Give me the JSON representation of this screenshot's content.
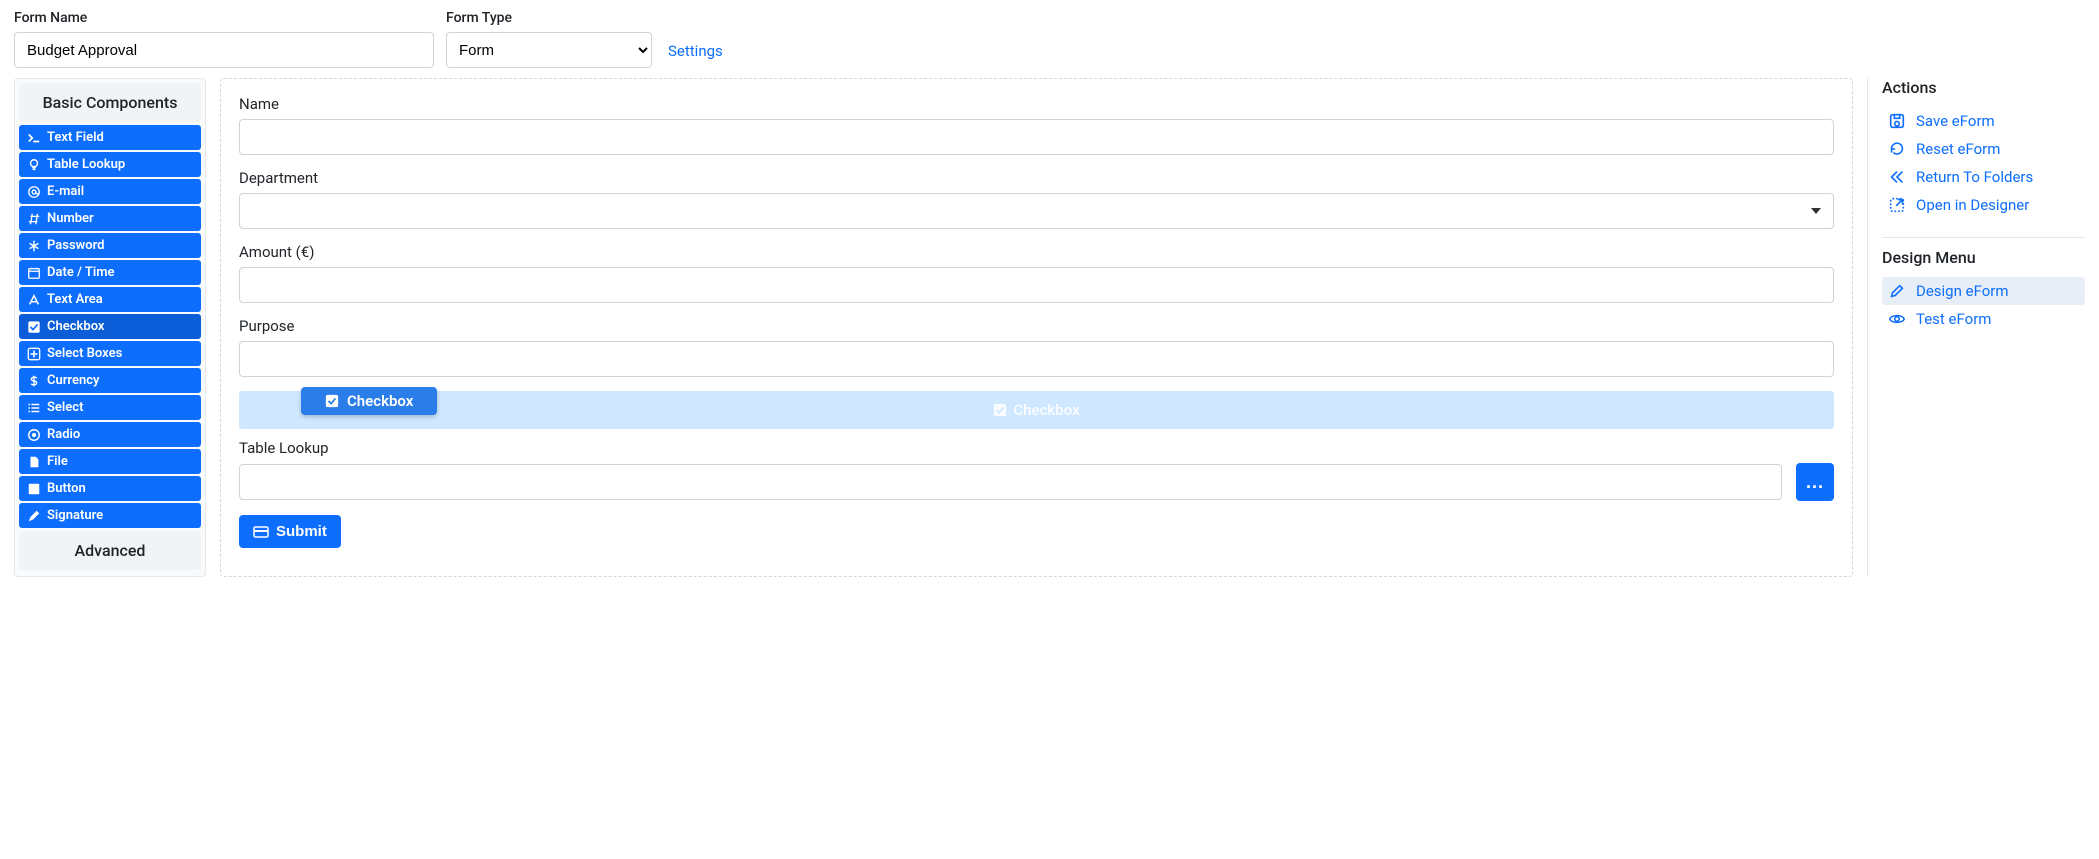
{
  "header": {
    "form_name_label": "Form Name",
    "form_name_value": "Budget Approval",
    "form_type_label": "Form Type",
    "form_type_value": "Form",
    "settings_link": "Settings"
  },
  "palette": {
    "basic_title": "Basic Components",
    "advanced_title": "Advanced",
    "items": [
      {
        "icon": "terminal",
        "label": "Text Field"
      },
      {
        "icon": "lightbulb",
        "label": "Table Lookup"
      },
      {
        "icon": "at",
        "label": "E-mail"
      },
      {
        "icon": "hash",
        "label": "Number"
      },
      {
        "icon": "asterisk",
        "label": "Password"
      },
      {
        "icon": "calendar",
        "label": "Date / Time"
      },
      {
        "icon": "font",
        "label": "Text Area"
      },
      {
        "icon": "check-square",
        "label": "Checkbox",
        "active": true
      },
      {
        "icon": "plus-square",
        "label": "Select Boxes"
      },
      {
        "icon": "dollar",
        "label": "Currency"
      },
      {
        "icon": "list",
        "label": "Select"
      },
      {
        "icon": "dot-circle",
        "label": "Radio"
      },
      {
        "icon": "file",
        "label": "File"
      },
      {
        "icon": "square",
        "label": "Button"
      },
      {
        "icon": "pen",
        "label": "Signature"
      }
    ]
  },
  "canvas": {
    "fields": {
      "name_label": "Name",
      "department_label": "Department",
      "amount_label": "Amount (€)",
      "purpose_label": "Purpose",
      "lookup_label": "Table Lookup",
      "lookup_btn": "..."
    },
    "drag": {
      "chip_label": "Checkbox",
      "ghost_label": "Checkbox"
    },
    "submit_label": "Submit"
  },
  "right": {
    "actions_heading": "Actions",
    "actions": [
      {
        "icon": "save",
        "label": "Save eForm"
      },
      {
        "icon": "reset",
        "label": "Reset eForm"
      },
      {
        "icon": "back",
        "label": "Return To Folders"
      },
      {
        "icon": "open",
        "label": "Open in Designer"
      }
    ],
    "design_heading": "Design Menu",
    "design_menu": [
      {
        "icon": "pencil",
        "label": "Design eForm",
        "selected": true
      },
      {
        "icon": "eye",
        "label": "Test eForm"
      }
    ]
  }
}
